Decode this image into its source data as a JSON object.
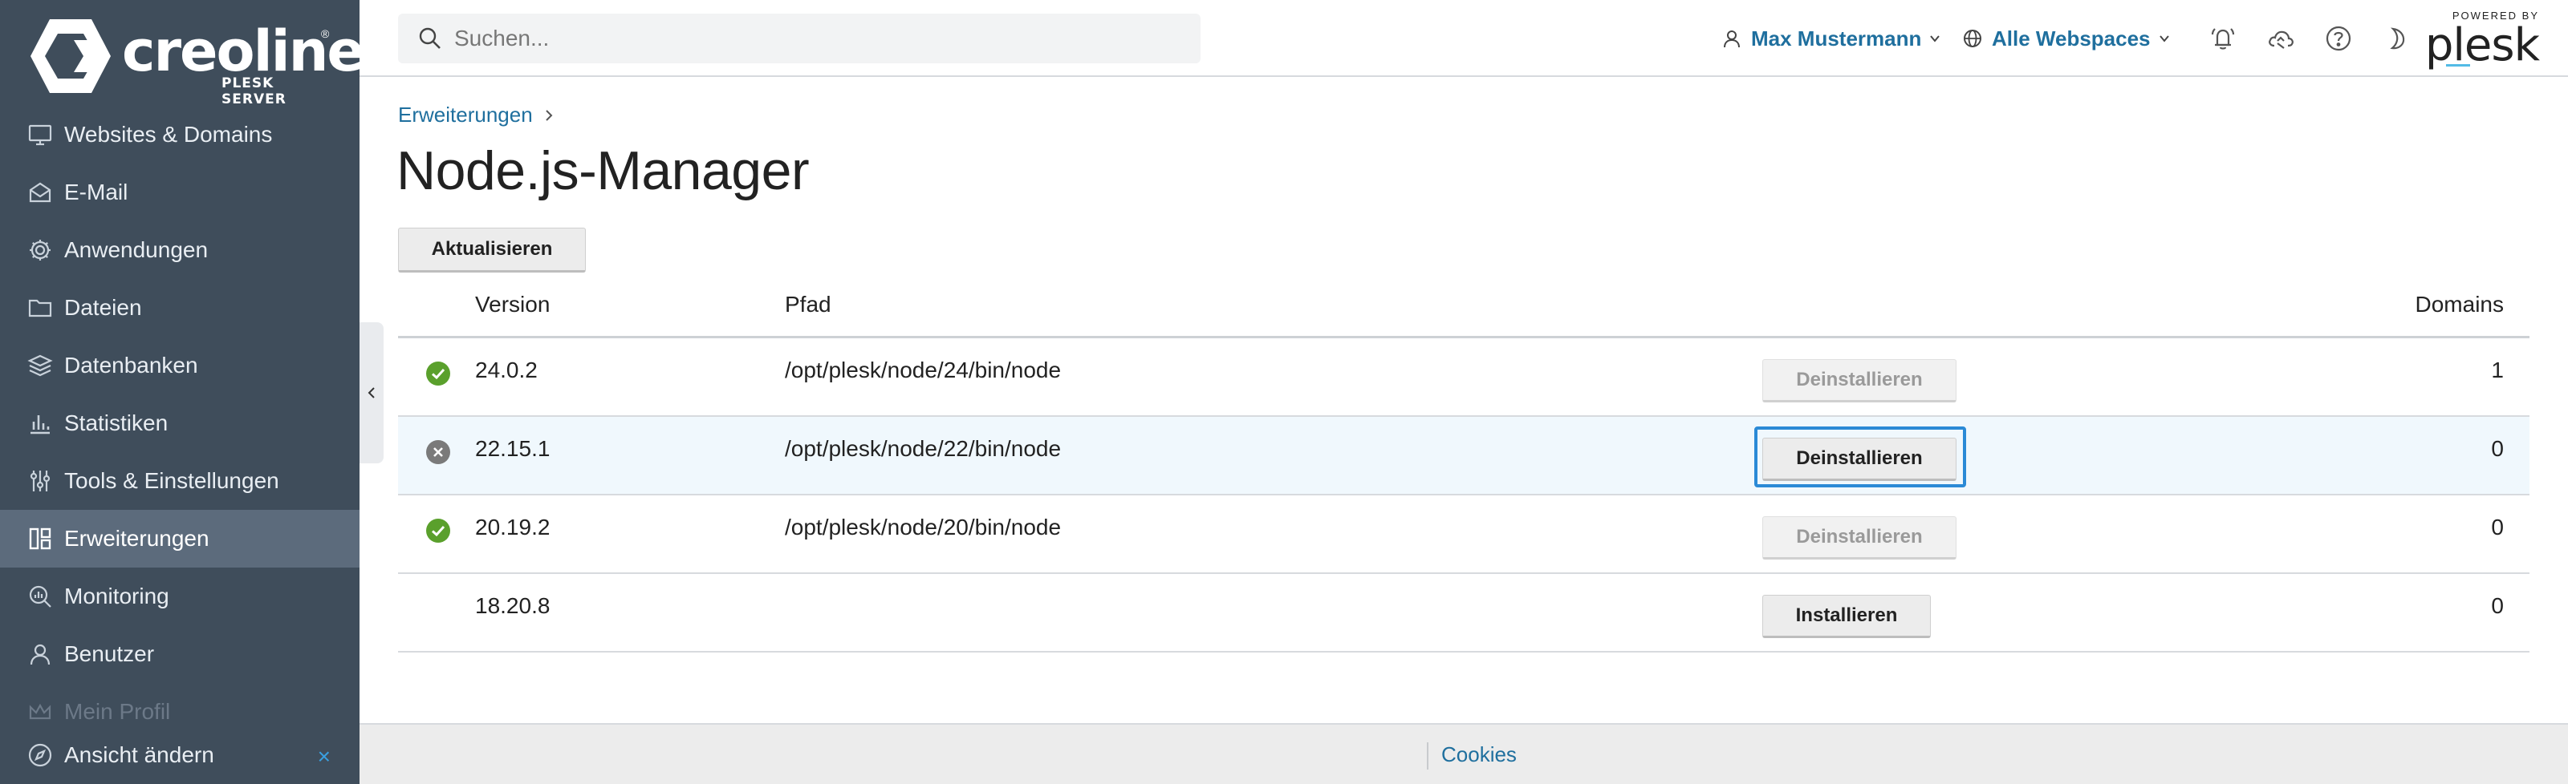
{
  "brand": {
    "name": "creoline",
    "registered": "®",
    "subtitle": "PLESK SERVER"
  },
  "sidebar": {
    "items": [
      {
        "label": "Websites & Domains",
        "icon": "monitor-icon"
      },
      {
        "label": "E-Mail",
        "icon": "envelope-icon"
      },
      {
        "label": "Anwendungen",
        "icon": "gear-icon"
      },
      {
        "label": "Dateien",
        "icon": "folder-icon"
      },
      {
        "label": "Datenbanken",
        "icon": "database-layers-icon"
      },
      {
        "label": "Statistiken",
        "icon": "bar-chart-icon"
      },
      {
        "label": "Tools & Einstellungen",
        "icon": "sliders-icon"
      },
      {
        "label": "Erweiterungen",
        "icon": "extensions-icon",
        "active": true
      },
      {
        "label": "Monitoring",
        "icon": "magnifier-chart-icon"
      },
      {
        "label": "Benutzer",
        "icon": "user-icon"
      },
      {
        "label": "Mein Profil",
        "icon": "crown-icon"
      }
    ],
    "bottom": {
      "label": "Ansicht ändern",
      "icon": "compass-icon",
      "close": "×"
    }
  },
  "topbar": {
    "search_placeholder": "Suchen...",
    "user": "Max Mustermann",
    "webspaces": "Alle Webspaces",
    "powered_by": "POWERED BY",
    "plesk": "plesk"
  },
  "breadcrumb": {
    "label": "Erweiterungen"
  },
  "page_title": "Node.js-Manager",
  "toolbar": {
    "refresh_label": "Aktualisieren"
  },
  "table": {
    "headers": {
      "version": "Version",
      "path": "Pfad",
      "domains": "Domains"
    },
    "rows": [
      {
        "status": "enabled",
        "version": "24.0.2",
        "path": "/opt/plesk/node/24/bin/node",
        "action": "Deinstallieren",
        "action_disabled": true,
        "domains": "1"
      },
      {
        "status": "disabled",
        "version": "22.15.1",
        "path": "/opt/plesk/node/22/bin/node",
        "action": "Deinstallieren",
        "action_disabled": false,
        "domains": "0"
      },
      {
        "status": "enabled",
        "version": "20.19.2",
        "path": "/opt/plesk/node/20/bin/node",
        "action": "Deinstallieren",
        "action_disabled": true,
        "domains": "0"
      },
      {
        "status": "none",
        "version": "18.20.8",
        "path": "",
        "action": "Installieren",
        "action_disabled": false,
        "domains": "0"
      }
    ]
  },
  "footer": {
    "cookies": "Cookies"
  },
  "colors": {
    "sidebar_bg": "#3f4d5b",
    "sidebar_active": "#5c6b7c",
    "link": "#1f6f9e",
    "status_ok": "#5aa02c",
    "status_off": "#7a7a7a",
    "focus": "#2b8ad6"
  }
}
